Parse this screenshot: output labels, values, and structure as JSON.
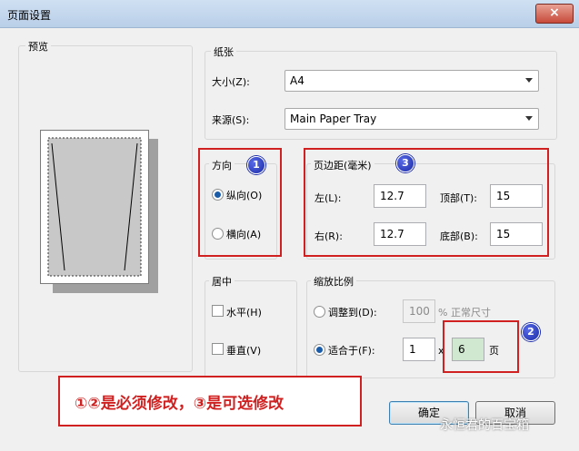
{
  "window": {
    "title": "页面设置",
    "close_label": "×"
  },
  "preview": {
    "label": "预览"
  },
  "paper": {
    "label": "纸张",
    "size_label": "大小(Z):",
    "size_value": "A4",
    "source_label": "来源(S):",
    "source_value": "Main Paper Tray"
  },
  "orientation": {
    "label": "方向",
    "portrait_label": "纵向(O)",
    "landscape_label": "横向(A)",
    "selected": "portrait"
  },
  "margins": {
    "label": "页边距(毫米)",
    "left_label": "左(L):",
    "left_value": "12.7",
    "right_label": "右(R):",
    "right_value": "12.7",
    "top_label": "顶部(T):",
    "top_value": "15",
    "bottom_label": "底部(B):",
    "bottom_value": "15"
  },
  "center": {
    "label": "居中",
    "horizontal_label": "水平(H)",
    "vertical_label": "垂直(V)"
  },
  "scaling": {
    "label": "缩放比例",
    "adjust_label": "调整到(D):",
    "adjust_value": "100",
    "adjust_suffix": "% 正常尺寸",
    "fit_label": "适合于(F):",
    "fit_wide_value": "1",
    "fit_x": "x",
    "fit_tall_value": "6",
    "fit_suffix": "页",
    "selected": "fit"
  },
  "buttons": {
    "ok": "确定",
    "cancel": "取消"
  },
  "annotations": {
    "badge1": "1",
    "badge2": "2",
    "badge3": "3",
    "note": "①②是必须修改，③是可选修改",
    "color": "#d02020"
  },
  "watermark": "永恒君的百宝箱"
}
